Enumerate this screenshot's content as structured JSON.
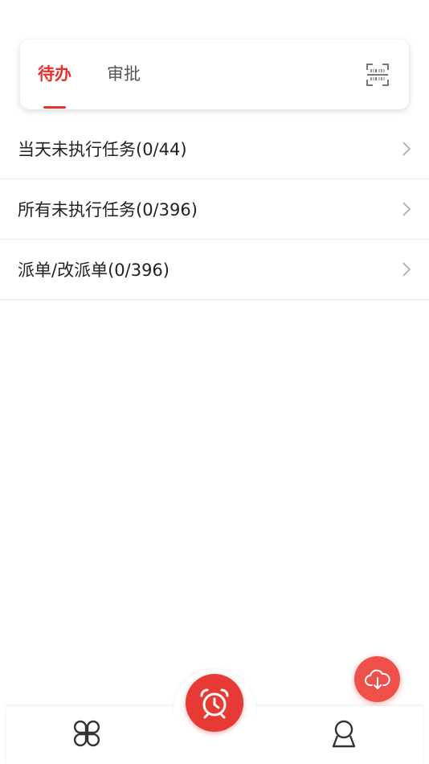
{
  "tabs": {
    "todo_label": "待办",
    "approve_label": "审批"
  },
  "tasks": [
    {
      "label": "当天未执行任务(0/44)"
    },
    {
      "label": "所有未执行任务(0/396)"
    },
    {
      "label": "派单/改派单(0/396)"
    }
  ],
  "icons": {
    "scan": "barcode-scan-icon",
    "chevron": "chevron-right-icon",
    "home": "grid-clover-icon",
    "center": "alarm-clock-icon",
    "profile": "user-icon",
    "download": "cloud-download-icon"
  },
  "colors": {
    "accent": "#e8312f",
    "fab": "#f0504a"
  }
}
